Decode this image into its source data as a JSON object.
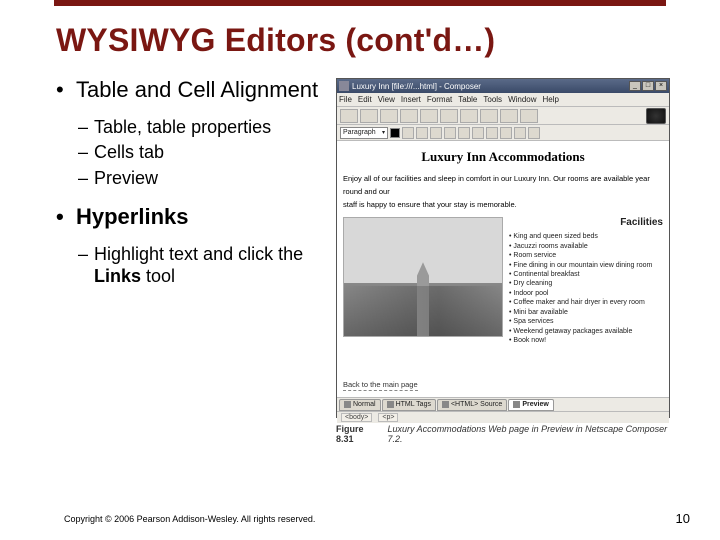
{
  "slide": {
    "title": "WYSIWYG Editors (cont'd…)",
    "bullets": {
      "b1a": "Table and Cell Alignment",
      "b1a_sub": {
        "s1": "Table, table properties",
        "s2": "Cells tab",
        "s3": "Preview"
      },
      "b1b": "Hyperlinks",
      "b1b_sub": {
        "s1_pre": "Highlight text and click the ",
        "s1_bold": "Links",
        "s1_post": " tool"
      }
    },
    "copyright": "Copyright © 2006 Pearson Addison-Wesley. All rights reserved.",
    "page_number": "10"
  },
  "figure": {
    "window_title": "Luxury Inn [file:///...html] - Composer",
    "menus": {
      "m1": "File",
      "m2": "Edit",
      "m3": "View",
      "m4": "Insert",
      "m5": "Format",
      "m6": "Table",
      "m7": "Tools",
      "m8": "Window",
      "m9": "Help"
    },
    "format_dropdown": "Paragraph",
    "page": {
      "heading": "Luxury Inn Accommodations",
      "intro_a": "Enjoy all of our facilities and sleep in comfort in our Luxury Inn. Our rooms are available year round and our",
      "intro_b": "staff is happy to ensure that your stay is memorable.",
      "facilities_title": "Facilities",
      "facilities": {
        "f1": "King and queen sized beds",
        "f2": "Jacuzzi rooms available",
        "f3": "Room service",
        "f4": "Fine dining in our mountain view dining room",
        "f5": "Continental breakfast",
        "f6": "Dry cleaning",
        "f7": "Indoor pool",
        "f8": "Coffee maker and hair dryer in every room",
        "f9": "Mini bar available",
        "f10": "Spa services",
        "f11": "Weekend getaway packages available",
        "f12": "Book now!"
      },
      "back_link": "Back to the main page"
    },
    "tabs": {
      "t1": "Normal",
      "t2": "HTML Tags",
      "t3": "<HTML> Source",
      "t4": "Preview"
    },
    "status": {
      "s1": "<body>",
      "s2": "<p>"
    },
    "caption_num": "Figure 8.31",
    "caption_text": "Luxury Accommodations Web page in Preview in Netscape Composer 7.2."
  }
}
